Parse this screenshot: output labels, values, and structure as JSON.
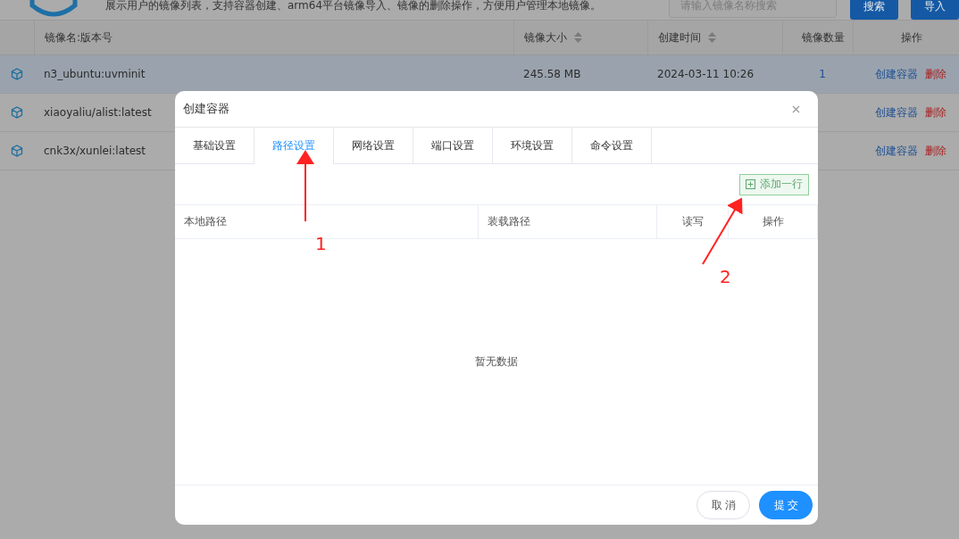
{
  "header": {
    "description": "展示用户的镜像列表，支持容器创建、arm64平台镜像导入、镜像的删除操作，方便用户管理本地镜像。",
    "search": {
      "placeholder": "请输入镜像名称搜索"
    },
    "buttons": [
      "搜索",
      "导入"
    ]
  },
  "table": {
    "columns": [
      {
        "label": "镜像名:版本号",
        "sortable": false
      },
      {
        "label": "镜像大小",
        "sortable": true
      },
      {
        "label": "创建时间",
        "sortable": true
      },
      {
        "label": "镜像数量",
        "sortable": false
      },
      {
        "label": "操作",
        "sortable": false
      }
    ],
    "rows": [
      {
        "name": "n3_ubuntu:uvminit",
        "size": "245.58 MB",
        "created": "2024-03-11 10:26",
        "count": "1",
        "actions": [
          "创建容器",
          "删除"
        ],
        "selected": true
      },
      {
        "name": "xiaoyaliu/alist:latest",
        "actions": [
          "创建容器",
          "删除"
        ],
        "selected": false
      },
      {
        "name": "cnk3x/xunlei:latest",
        "actions": [
          "创建容器",
          "删除"
        ],
        "selected": false
      }
    ]
  },
  "dialog": {
    "title": "创建容器",
    "tabs": [
      {
        "label": "基础设置",
        "selected": false
      },
      {
        "label": "路径设置",
        "selected": true
      },
      {
        "label": "网络设置",
        "selected": false
      },
      {
        "label": "端口设置",
        "selected": false
      },
      {
        "label": "环境设置",
        "selected": false
      },
      {
        "label": "命令设置",
        "selected": false
      }
    ],
    "add_button": "添加一行",
    "columns": [
      "本地路径",
      "装载路径",
      "读写",
      "操作"
    ],
    "empty_text": "暂无数据",
    "buttons": [
      {
        "label": "取消",
        "kind": "default"
      },
      {
        "label": "提交",
        "kind": "primary"
      }
    ]
  },
  "annotations": [
    {
      "label": "1"
    },
    {
      "label": "2"
    }
  ]
}
